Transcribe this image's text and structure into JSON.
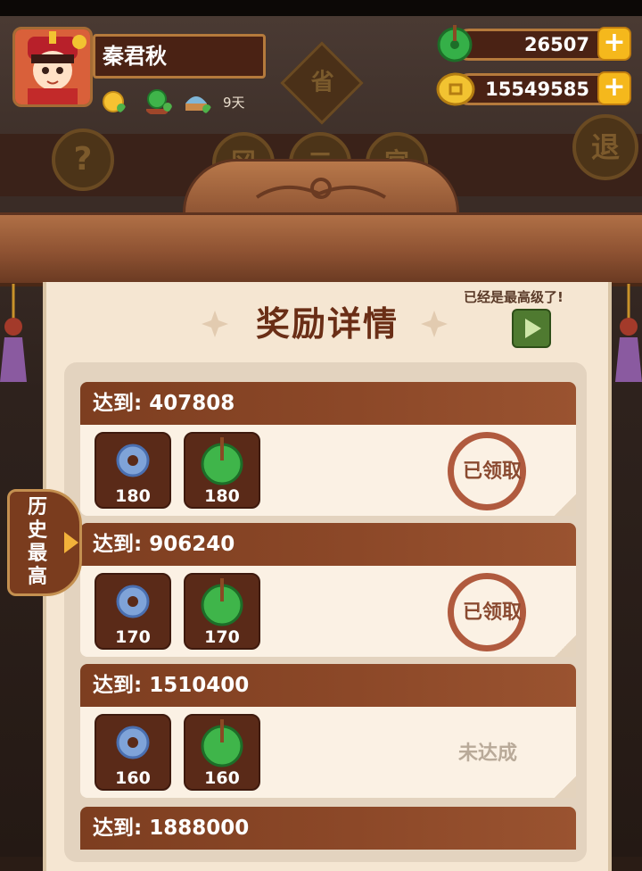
{
  "player": {
    "name": "秦君秋",
    "days_label": "9天"
  },
  "currency": {
    "jade": "26507",
    "coins": "15549585",
    "plus_symbol": "+"
  },
  "background": {
    "left_button": "?",
    "right_button": "退",
    "top_tag": "省",
    "tags": [
      "冈",
      "二",
      "宫"
    ]
  },
  "panel": {
    "title": "奖励详情",
    "max_level_note": "已经是最高级了!"
  },
  "side_tab": {
    "label": "历史最高"
  },
  "rewards": [
    {
      "target_label": "达到:",
      "target": "407808",
      "items": [
        "180",
        "180"
      ],
      "status": "已领取",
      "claimed": true
    },
    {
      "target_label": "达到:",
      "target": "906240",
      "items": [
        "170",
        "170"
      ],
      "status": "已领取",
      "claimed": true
    },
    {
      "target_label": "达到:",
      "target": "1510400",
      "items": [
        "160",
        "160"
      ],
      "status": "未达成",
      "claimed": false
    },
    {
      "target_label": "达到:",
      "target": "1888000"
    }
  ],
  "icons": {
    "item_1": "blue-jade-disc-icon",
    "item_2": "green-jade-pendant-icon"
  },
  "colors": {
    "header_brown": "#7d3e20",
    "parchment": "#f5e6d2",
    "plus_gold": "#f5b81c",
    "stamp_red": "#b05a3e"
  }
}
